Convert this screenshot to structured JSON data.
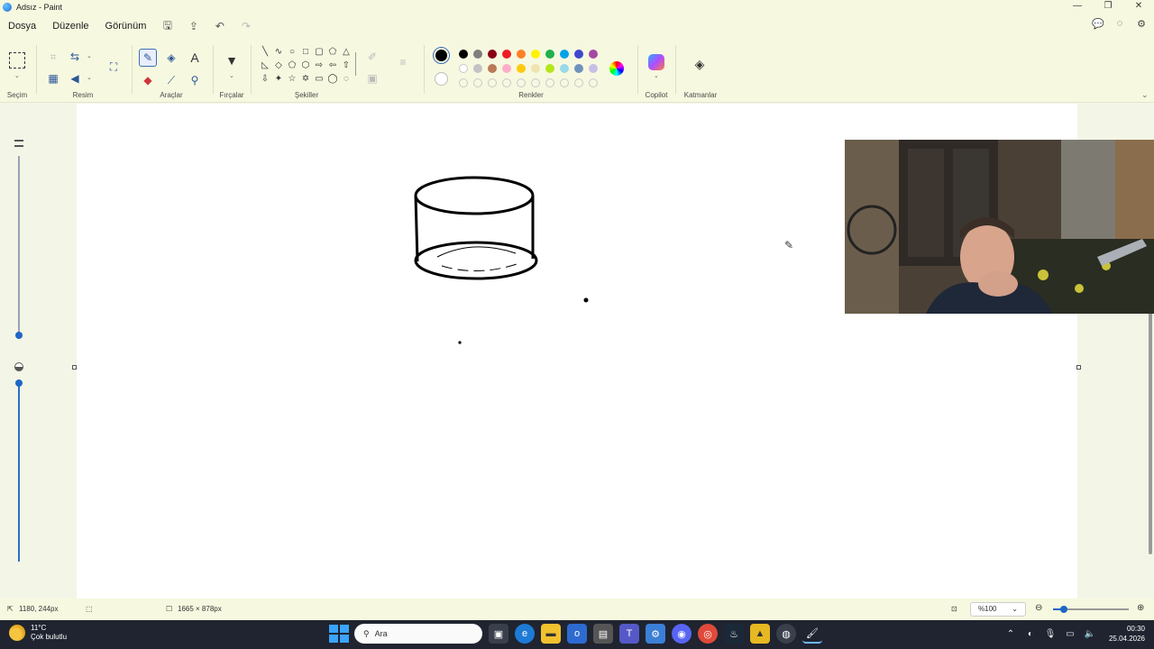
{
  "window": {
    "title": "Adsız - Paint",
    "controls": [
      "—",
      "❐",
      "✕"
    ]
  },
  "menu": {
    "items": [
      "Dosya",
      "Düzenle",
      "Görünüm"
    ]
  },
  "ribbon": {
    "groups": {
      "selection": "Seçim",
      "image": "Resim",
      "tools": "Araçlar",
      "brushes": "Fırçalar",
      "shapes": "Şekiller",
      "colors": "Renkler",
      "copilot": "Copilot",
      "layers": "Katmanlar"
    },
    "text_tool": "A",
    "palette_row1": [
      "#000000",
      "#7f7f7f",
      "#880015",
      "#ed1c24",
      "#ff7f27",
      "#fff200",
      "#22b14c",
      "#00a2e8",
      "#3f48cc",
      "#a349a4"
    ],
    "palette_row2": [
      "#ffffff",
      "#c3c3c3",
      "#b97a57",
      "#ffaec9",
      "#ffc90e",
      "#efe4b0",
      "#b5e61d",
      "#99d9ea",
      "#7092be",
      "#c8bfe7"
    ],
    "primary_color": "#000000",
    "secondary_color": "#ffffff"
  },
  "statusbar": {
    "cursor_pos": "1180, 244px",
    "canvas_size": "1665 × 878px",
    "zoom": "%100"
  },
  "taskbar": {
    "weather_temp": "11°C",
    "weather_desc": "Çok bulutlu",
    "search_placeholder": "Ara",
    "time": "00:30",
    "date": "25.04.2026"
  }
}
